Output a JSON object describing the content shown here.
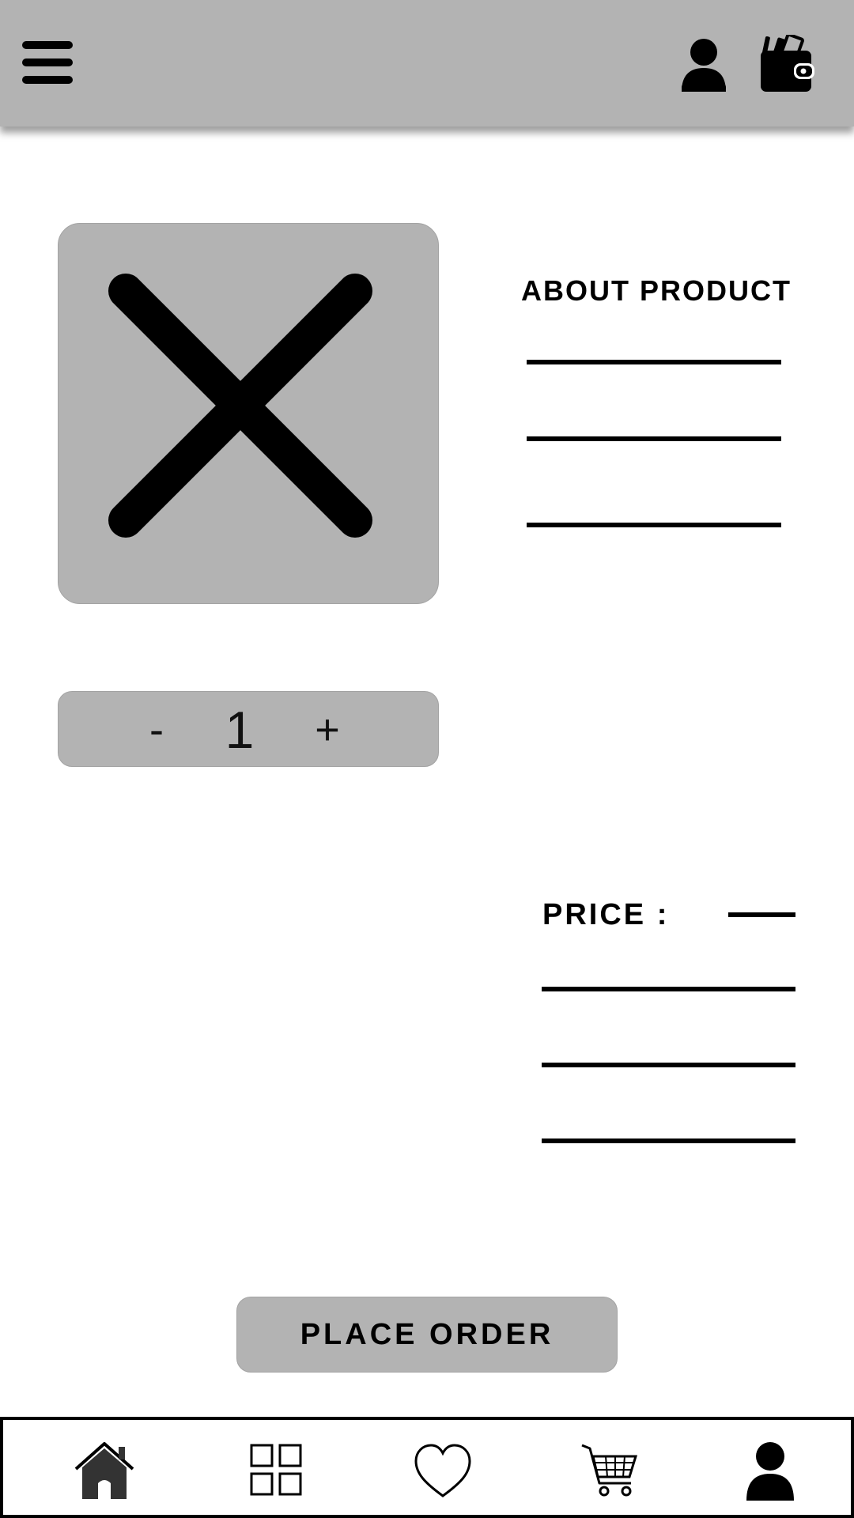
{
  "header": {
    "menu_icon": "hamburger-menu-icon",
    "profile_icon": "user-icon",
    "wallet_icon": "wallet-icon",
    "background_color": "#b3b3b3"
  },
  "product": {
    "image_placeholder_icon": "close-x-icon",
    "about_title": "ABOUT PRODUCT"
  },
  "quantity": {
    "minus_label": "-",
    "value": "1",
    "plus_label": "+"
  },
  "price": {
    "label": "PRICE :"
  },
  "actions": {
    "place_order_label": "PLACE ORDER"
  },
  "bottom_nav": {
    "items": [
      {
        "icon": "home-icon"
      },
      {
        "icon": "grid-icon"
      },
      {
        "icon": "heart-icon"
      },
      {
        "icon": "cart-icon"
      },
      {
        "icon": "user-icon"
      }
    ]
  },
  "colors": {
    "panel_gray": "#b3b3b3",
    "ink": "#000000"
  }
}
